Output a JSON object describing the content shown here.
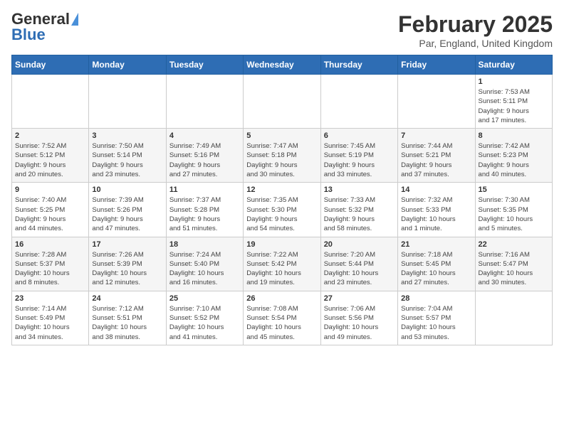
{
  "logo": {
    "line1": "General",
    "line2": "Blue"
  },
  "title": "February 2025",
  "subtitle": "Par, England, United Kingdom",
  "weekdays": [
    "Sunday",
    "Monday",
    "Tuesday",
    "Wednesday",
    "Thursday",
    "Friday",
    "Saturday"
  ],
  "weeks": [
    [
      {
        "day": "",
        "info": ""
      },
      {
        "day": "",
        "info": ""
      },
      {
        "day": "",
        "info": ""
      },
      {
        "day": "",
        "info": ""
      },
      {
        "day": "",
        "info": ""
      },
      {
        "day": "",
        "info": ""
      },
      {
        "day": "1",
        "info": "Sunrise: 7:53 AM\nSunset: 5:11 PM\nDaylight: 9 hours\nand 17 minutes."
      }
    ],
    [
      {
        "day": "2",
        "info": "Sunrise: 7:52 AM\nSunset: 5:12 PM\nDaylight: 9 hours\nand 20 minutes."
      },
      {
        "day": "3",
        "info": "Sunrise: 7:50 AM\nSunset: 5:14 PM\nDaylight: 9 hours\nand 23 minutes."
      },
      {
        "day": "4",
        "info": "Sunrise: 7:49 AM\nSunset: 5:16 PM\nDaylight: 9 hours\nand 27 minutes."
      },
      {
        "day": "5",
        "info": "Sunrise: 7:47 AM\nSunset: 5:18 PM\nDaylight: 9 hours\nand 30 minutes."
      },
      {
        "day": "6",
        "info": "Sunrise: 7:45 AM\nSunset: 5:19 PM\nDaylight: 9 hours\nand 33 minutes."
      },
      {
        "day": "7",
        "info": "Sunrise: 7:44 AM\nSunset: 5:21 PM\nDaylight: 9 hours\nand 37 minutes."
      },
      {
        "day": "8",
        "info": "Sunrise: 7:42 AM\nSunset: 5:23 PM\nDaylight: 9 hours\nand 40 minutes."
      }
    ],
    [
      {
        "day": "9",
        "info": "Sunrise: 7:40 AM\nSunset: 5:25 PM\nDaylight: 9 hours\nand 44 minutes."
      },
      {
        "day": "10",
        "info": "Sunrise: 7:39 AM\nSunset: 5:26 PM\nDaylight: 9 hours\nand 47 minutes."
      },
      {
        "day": "11",
        "info": "Sunrise: 7:37 AM\nSunset: 5:28 PM\nDaylight: 9 hours\nand 51 minutes."
      },
      {
        "day": "12",
        "info": "Sunrise: 7:35 AM\nSunset: 5:30 PM\nDaylight: 9 hours\nand 54 minutes."
      },
      {
        "day": "13",
        "info": "Sunrise: 7:33 AM\nSunset: 5:32 PM\nDaylight: 9 hours\nand 58 minutes."
      },
      {
        "day": "14",
        "info": "Sunrise: 7:32 AM\nSunset: 5:33 PM\nDaylight: 10 hours\nand 1 minute."
      },
      {
        "day": "15",
        "info": "Sunrise: 7:30 AM\nSunset: 5:35 PM\nDaylight: 10 hours\nand 5 minutes."
      }
    ],
    [
      {
        "day": "16",
        "info": "Sunrise: 7:28 AM\nSunset: 5:37 PM\nDaylight: 10 hours\nand 8 minutes."
      },
      {
        "day": "17",
        "info": "Sunrise: 7:26 AM\nSunset: 5:39 PM\nDaylight: 10 hours\nand 12 minutes."
      },
      {
        "day": "18",
        "info": "Sunrise: 7:24 AM\nSunset: 5:40 PM\nDaylight: 10 hours\nand 16 minutes."
      },
      {
        "day": "19",
        "info": "Sunrise: 7:22 AM\nSunset: 5:42 PM\nDaylight: 10 hours\nand 19 minutes."
      },
      {
        "day": "20",
        "info": "Sunrise: 7:20 AM\nSunset: 5:44 PM\nDaylight: 10 hours\nand 23 minutes."
      },
      {
        "day": "21",
        "info": "Sunrise: 7:18 AM\nSunset: 5:45 PM\nDaylight: 10 hours\nand 27 minutes."
      },
      {
        "day": "22",
        "info": "Sunrise: 7:16 AM\nSunset: 5:47 PM\nDaylight: 10 hours\nand 30 minutes."
      }
    ],
    [
      {
        "day": "23",
        "info": "Sunrise: 7:14 AM\nSunset: 5:49 PM\nDaylight: 10 hours\nand 34 minutes."
      },
      {
        "day": "24",
        "info": "Sunrise: 7:12 AM\nSunset: 5:51 PM\nDaylight: 10 hours\nand 38 minutes."
      },
      {
        "day": "25",
        "info": "Sunrise: 7:10 AM\nSunset: 5:52 PM\nDaylight: 10 hours\nand 41 minutes."
      },
      {
        "day": "26",
        "info": "Sunrise: 7:08 AM\nSunset: 5:54 PM\nDaylight: 10 hours\nand 45 minutes."
      },
      {
        "day": "27",
        "info": "Sunrise: 7:06 AM\nSunset: 5:56 PM\nDaylight: 10 hours\nand 49 minutes."
      },
      {
        "day": "28",
        "info": "Sunrise: 7:04 AM\nSunset: 5:57 PM\nDaylight: 10 hours\nand 53 minutes."
      },
      {
        "day": "",
        "info": ""
      }
    ]
  ]
}
